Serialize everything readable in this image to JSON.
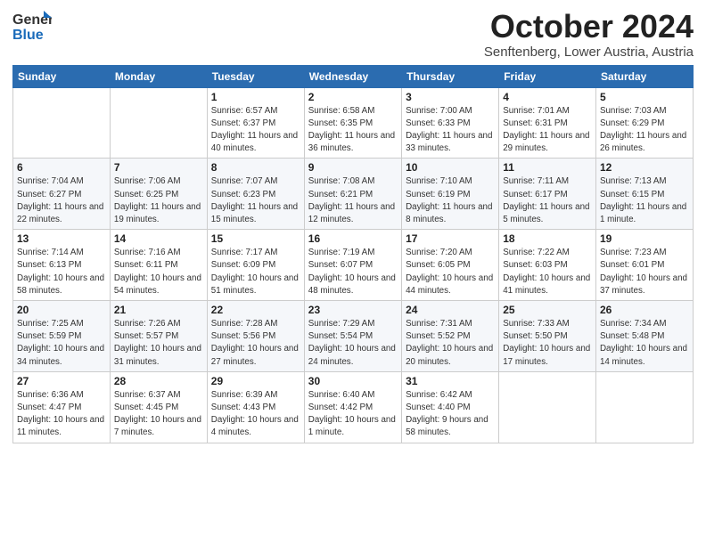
{
  "header": {
    "logo_general": "General",
    "logo_blue": "Blue",
    "month_title": "October 2024",
    "location": "Senftenberg, Lower Austria, Austria"
  },
  "days_of_week": [
    "Sunday",
    "Monday",
    "Tuesday",
    "Wednesday",
    "Thursday",
    "Friday",
    "Saturday"
  ],
  "weeks": [
    [
      {
        "day": "",
        "sunrise": "",
        "sunset": "",
        "daylight": ""
      },
      {
        "day": "",
        "sunrise": "",
        "sunset": "",
        "daylight": ""
      },
      {
        "day": "1",
        "sunrise": "Sunrise: 6:57 AM",
        "sunset": "Sunset: 6:37 PM",
        "daylight": "Daylight: 11 hours and 40 minutes."
      },
      {
        "day": "2",
        "sunrise": "Sunrise: 6:58 AM",
        "sunset": "Sunset: 6:35 PM",
        "daylight": "Daylight: 11 hours and 36 minutes."
      },
      {
        "day": "3",
        "sunrise": "Sunrise: 7:00 AM",
        "sunset": "Sunset: 6:33 PM",
        "daylight": "Daylight: 11 hours and 33 minutes."
      },
      {
        "day": "4",
        "sunrise": "Sunrise: 7:01 AM",
        "sunset": "Sunset: 6:31 PM",
        "daylight": "Daylight: 11 hours and 29 minutes."
      },
      {
        "day": "5",
        "sunrise": "Sunrise: 7:03 AM",
        "sunset": "Sunset: 6:29 PM",
        "daylight": "Daylight: 11 hours and 26 minutes."
      }
    ],
    [
      {
        "day": "6",
        "sunrise": "Sunrise: 7:04 AM",
        "sunset": "Sunset: 6:27 PM",
        "daylight": "Daylight: 11 hours and 22 minutes."
      },
      {
        "day": "7",
        "sunrise": "Sunrise: 7:06 AM",
        "sunset": "Sunset: 6:25 PM",
        "daylight": "Daylight: 11 hours and 19 minutes."
      },
      {
        "day": "8",
        "sunrise": "Sunrise: 7:07 AM",
        "sunset": "Sunset: 6:23 PM",
        "daylight": "Daylight: 11 hours and 15 minutes."
      },
      {
        "day": "9",
        "sunrise": "Sunrise: 7:08 AM",
        "sunset": "Sunset: 6:21 PM",
        "daylight": "Daylight: 11 hours and 12 minutes."
      },
      {
        "day": "10",
        "sunrise": "Sunrise: 7:10 AM",
        "sunset": "Sunset: 6:19 PM",
        "daylight": "Daylight: 11 hours and 8 minutes."
      },
      {
        "day": "11",
        "sunrise": "Sunrise: 7:11 AM",
        "sunset": "Sunset: 6:17 PM",
        "daylight": "Daylight: 11 hours and 5 minutes."
      },
      {
        "day": "12",
        "sunrise": "Sunrise: 7:13 AM",
        "sunset": "Sunset: 6:15 PM",
        "daylight": "Daylight: 11 hours and 1 minute."
      }
    ],
    [
      {
        "day": "13",
        "sunrise": "Sunrise: 7:14 AM",
        "sunset": "Sunset: 6:13 PM",
        "daylight": "Daylight: 10 hours and 58 minutes."
      },
      {
        "day": "14",
        "sunrise": "Sunrise: 7:16 AM",
        "sunset": "Sunset: 6:11 PM",
        "daylight": "Daylight: 10 hours and 54 minutes."
      },
      {
        "day": "15",
        "sunrise": "Sunrise: 7:17 AM",
        "sunset": "Sunset: 6:09 PM",
        "daylight": "Daylight: 10 hours and 51 minutes."
      },
      {
        "day": "16",
        "sunrise": "Sunrise: 7:19 AM",
        "sunset": "Sunset: 6:07 PM",
        "daylight": "Daylight: 10 hours and 48 minutes."
      },
      {
        "day": "17",
        "sunrise": "Sunrise: 7:20 AM",
        "sunset": "Sunset: 6:05 PM",
        "daylight": "Daylight: 10 hours and 44 minutes."
      },
      {
        "day": "18",
        "sunrise": "Sunrise: 7:22 AM",
        "sunset": "Sunset: 6:03 PM",
        "daylight": "Daylight: 10 hours and 41 minutes."
      },
      {
        "day": "19",
        "sunrise": "Sunrise: 7:23 AM",
        "sunset": "Sunset: 6:01 PM",
        "daylight": "Daylight: 10 hours and 37 minutes."
      }
    ],
    [
      {
        "day": "20",
        "sunrise": "Sunrise: 7:25 AM",
        "sunset": "Sunset: 5:59 PM",
        "daylight": "Daylight: 10 hours and 34 minutes."
      },
      {
        "day": "21",
        "sunrise": "Sunrise: 7:26 AM",
        "sunset": "Sunset: 5:57 PM",
        "daylight": "Daylight: 10 hours and 31 minutes."
      },
      {
        "day": "22",
        "sunrise": "Sunrise: 7:28 AM",
        "sunset": "Sunset: 5:56 PM",
        "daylight": "Daylight: 10 hours and 27 minutes."
      },
      {
        "day": "23",
        "sunrise": "Sunrise: 7:29 AM",
        "sunset": "Sunset: 5:54 PM",
        "daylight": "Daylight: 10 hours and 24 minutes."
      },
      {
        "day": "24",
        "sunrise": "Sunrise: 7:31 AM",
        "sunset": "Sunset: 5:52 PM",
        "daylight": "Daylight: 10 hours and 20 minutes."
      },
      {
        "day": "25",
        "sunrise": "Sunrise: 7:33 AM",
        "sunset": "Sunset: 5:50 PM",
        "daylight": "Daylight: 10 hours and 17 minutes."
      },
      {
        "day": "26",
        "sunrise": "Sunrise: 7:34 AM",
        "sunset": "Sunset: 5:48 PM",
        "daylight": "Daylight: 10 hours and 14 minutes."
      }
    ],
    [
      {
        "day": "27",
        "sunrise": "Sunrise: 6:36 AM",
        "sunset": "Sunset: 4:47 PM",
        "daylight": "Daylight: 10 hours and 11 minutes."
      },
      {
        "day": "28",
        "sunrise": "Sunrise: 6:37 AM",
        "sunset": "Sunset: 4:45 PM",
        "daylight": "Daylight: 10 hours and 7 minutes."
      },
      {
        "day": "29",
        "sunrise": "Sunrise: 6:39 AM",
        "sunset": "Sunset: 4:43 PM",
        "daylight": "Daylight: 10 hours and 4 minutes."
      },
      {
        "day": "30",
        "sunrise": "Sunrise: 6:40 AM",
        "sunset": "Sunset: 4:42 PM",
        "daylight": "Daylight: 10 hours and 1 minute."
      },
      {
        "day": "31",
        "sunrise": "Sunrise: 6:42 AM",
        "sunset": "Sunset: 4:40 PM",
        "daylight": "Daylight: 9 hours and 58 minutes."
      },
      {
        "day": "",
        "sunrise": "",
        "sunset": "",
        "daylight": ""
      },
      {
        "day": "",
        "sunrise": "",
        "sunset": "",
        "daylight": ""
      }
    ]
  ]
}
